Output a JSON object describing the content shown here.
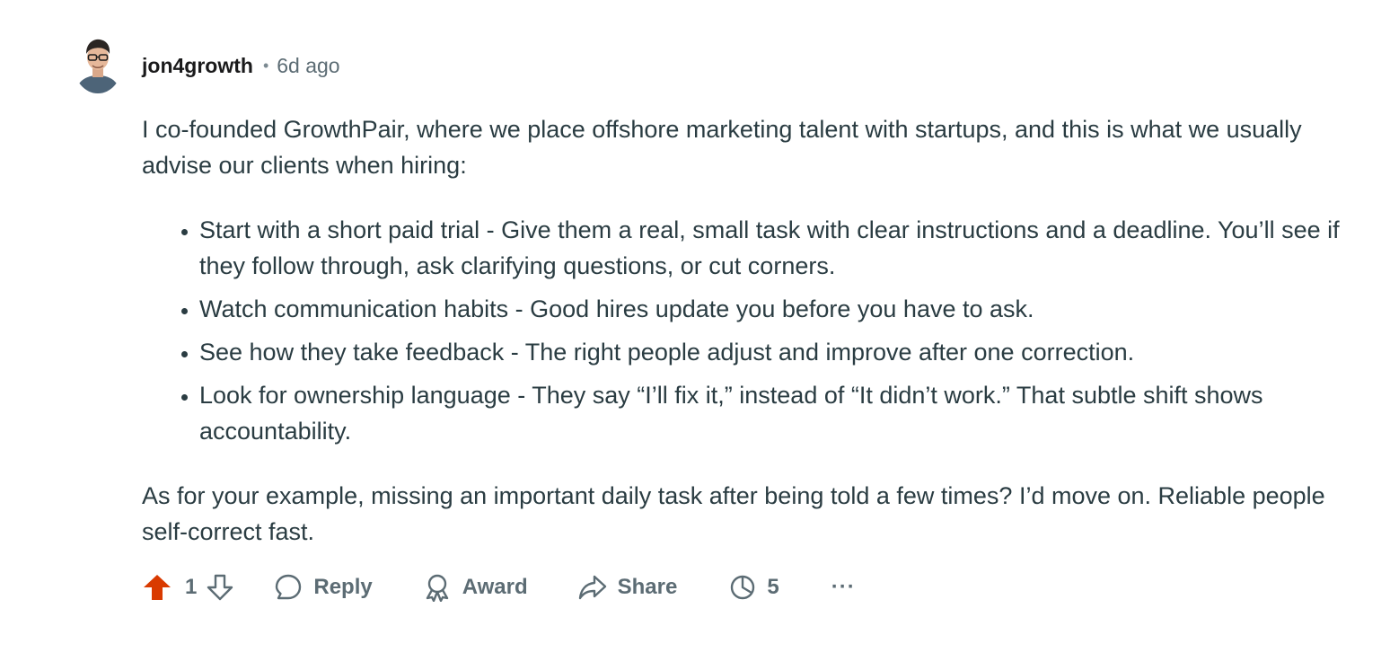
{
  "comment": {
    "author": "jon4growth",
    "separator": "•",
    "time": "6d ago",
    "intro": {
      "highlight1": "I co-founded GrowthPair,",
      "text1": " where we place ",
      "highlight2": "offshore marketing talent",
      "text2": " with startups, and this is what we usually advise our clients when hiring:"
    },
    "bullets": [
      "Start with a short paid trial - Give them a real, small task with clear instructions and a deadline. You’ll see if they follow through, ask clarifying questions, or cut corners.",
      "Watch communication habits - Good hires update you before you have to ask.",
      "See how they take feedback - The right people adjust and improve after one correction.",
      "Look for ownership language - They say “I’ll fix it,” instead of “It didn’t work.” That subtle shift shows accountability."
    ],
    "closing": "As for your example, missing an important daily task after being told a few times? I’d move on. Reliable people self-correct fast."
  },
  "actions": {
    "upvote_icon": "upvote-arrow-filled-icon",
    "vote_count": "1",
    "downvote_icon": "downvote-arrow-icon",
    "reply_label": "Reply",
    "award_label": "Award",
    "share_label": "Share",
    "insights_count": "5",
    "more_label": "···"
  },
  "colors": {
    "upvote": "#d93a00",
    "highlight": "#9fe33c",
    "text": "#2a3c42",
    "muted": "#5c6c74"
  }
}
